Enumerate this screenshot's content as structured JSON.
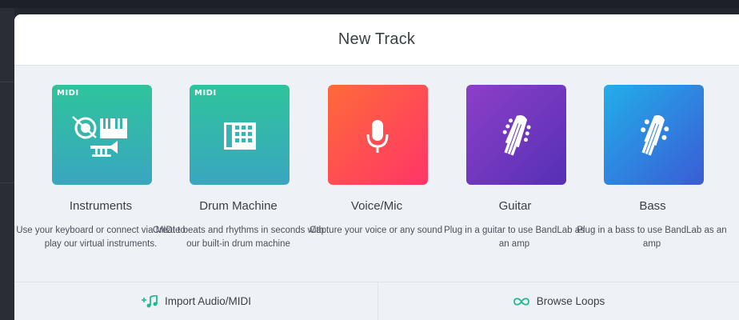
{
  "dialog": {
    "title": "New Track"
  },
  "options": [
    {
      "title": "Instruments",
      "description": "Use your keyboard or connect via MIDI to play our virtual instruments.",
      "badge": "MIDI",
      "icon": "piano-drum-trumpet-icon"
    },
    {
      "title": "Drum Machine",
      "description": "Create beats and rhythms in seconds with our built-in drum machine",
      "badge": "MIDI",
      "icon": "drum-pads-icon"
    },
    {
      "title": "Voice/Mic",
      "description": "Capture your voice or any sound",
      "icon": "microphone-icon"
    },
    {
      "title": "Guitar",
      "description": "Plug in a guitar to use BandLab as an amp",
      "icon": "guitar-headstock-icon"
    },
    {
      "title": "Bass",
      "description": "Plug in a bass to use BandLab as an amp",
      "icon": "bass-headstock-icon"
    }
  ],
  "footer": {
    "import_label": "Import Audio/MIDI",
    "browse_label": "Browse Loops",
    "import_icon": "music-note-plus-icon",
    "browse_icon": "infinity-icon"
  },
  "colors": {
    "instruments": [
      "#2ec49c",
      "#3aa6c0"
    ],
    "drum_machine": [
      "#2ec49c",
      "#3aa6c0"
    ],
    "voice": [
      "#ff5a3c",
      "#ff3a63"
    ],
    "guitar": [
      "#8a3bc5",
      "#5a2fb8"
    ],
    "bass": [
      "#23a8e8",
      "#3760d8"
    ],
    "accent_green": "#1fb892"
  }
}
